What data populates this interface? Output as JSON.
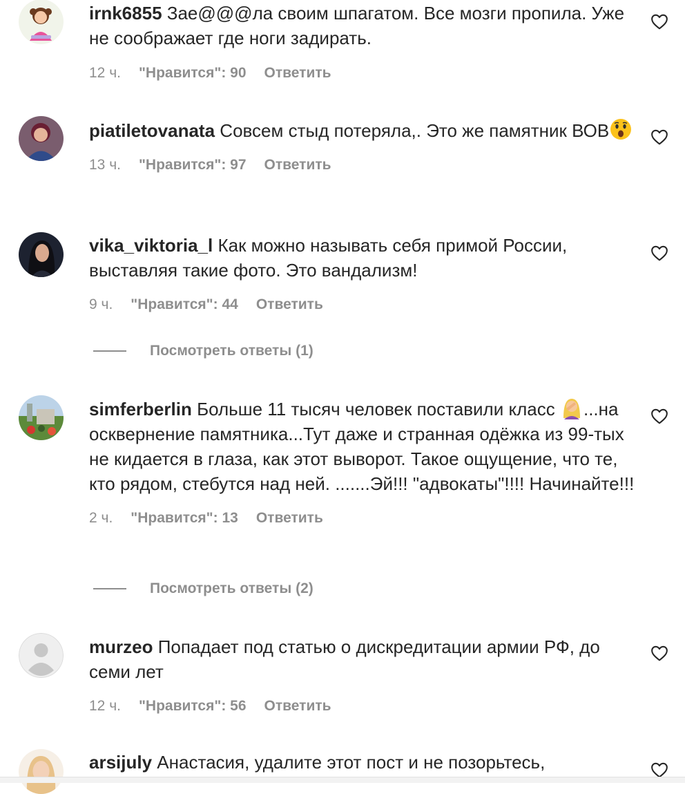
{
  "comments": [
    {
      "username": "irnk6855",
      "text": "Зае@@@ла своим шпагатом. Все мозги пропила. Уже не соображает где ноги задирать.",
      "time": "12 ч.",
      "likes": "\"Нравится\": 90",
      "reply": "Ответить"
    },
    {
      "username": "piatiletovanata",
      "text": "Совсем стыд потеряла,. Это же памятник ВОВ",
      "emoji": "astonished-face",
      "time": "13 ч.",
      "likes": "\"Нравится\": 97",
      "reply": "Ответить"
    },
    {
      "username": "vika_viktoria_l",
      "text": "Как можно называть себя примой России, выставляя такие фото. Это вандализм!",
      "time": "9 ч.",
      "likes": "\"Нравится\": 44",
      "reply": "Ответить",
      "view_replies": "Посмотреть ответы (1)"
    },
    {
      "username": "simferberlin",
      "text_before": "Больше 11 тысяч человек поставили класс",
      "emoji": "woman-facepalming",
      "text_after": "...на осквернение памятника...Тут даже и странная одёжка из 99-тых не кидается в глаза, как этот выворот. Такое ощущение, что те, кто рядом, стебутся над ней. .......Эй!!! \"адвокаты\"!!!! Начинайте!!!",
      "time": "2 ч.",
      "likes": "\"Нравится\": 13",
      "reply": "Ответить",
      "view_replies": "Посмотреть ответы (2)"
    },
    {
      "username": "murzeo",
      "text": "Попадает под статью о дискредитации армии РФ, до семи лет",
      "time": "12 ч.",
      "likes": "\"Нравится\": 56",
      "reply": "Ответить"
    },
    {
      "username": "arsijuly",
      "text": "Анастасия, удалите этот пост и не позорьтесь,"
    }
  ],
  "colors": {
    "text": "#262626",
    "secondary": "#8e8e8e",
    "background": "#ffffff"
  },
  "icons": {
    "like": "heart-outline-icon"
  }
}
